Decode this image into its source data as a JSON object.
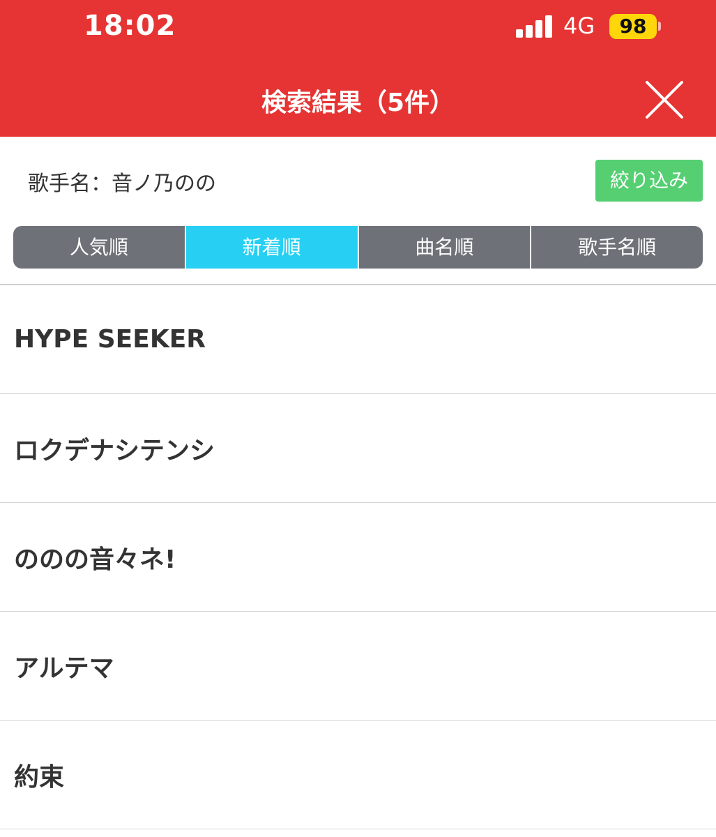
{
  "status_bar": {
    "time": "18:02",
    "network": "4G",
    "battery": "98"
  },
  "header": {
    "title": "検索結果（5件）",
    "close_icon": "close-icon"
  },
  "filter": {
    "label": "歌手名：音ノ乃のの",
    "button_label": "絞り込み"
  },
  "sort_tabs": [
    {
      "label": "人気順",
      "active": false
    },
    {
      "label": "新着順",
      "active": true
    },
    {
      "label": "曲名順",
      "active": false
    },
    {
      "label": "歌手名順",
      "active": false
    }
  ],
  "results": [
    {
      "title": "HYPE SEEKER"
    },
    {
      "title": "ロクデナシテンシ"
    },
    {
      "title": "ののの音々ネ!"
    },
    {
      "title": "アルテマ"
    },
    {
      "title": "約束"
    }
  ],
  "colors": {
    "header_bg": "#e53433",
    "active_tab": "#27d0f2",
    "inactive_tab": "#6e7278",
    "filter_button": "#55cf72"
  }
}
